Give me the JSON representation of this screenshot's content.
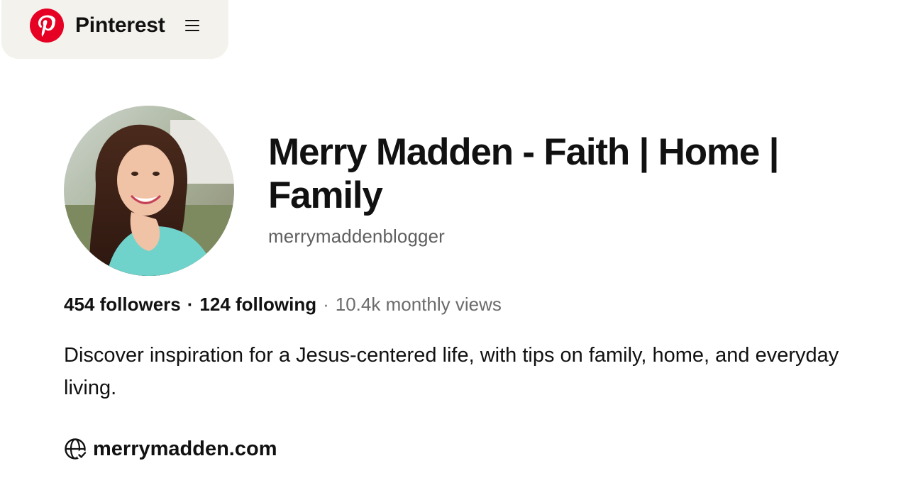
{
  "header": {
    "brand_name": "Pinterest",
    "logo_icon": "pinterest-logo",
    "menu_icon": "hamburger-menu-icon",
    "brand_color": "#e60023",
    "pill_color": "#f4f2ed"
  },
  "profile": {
    "avatar": "profile-photo",
    "name": "Merry Madden - Faith | Home | Family",
    "username": "merrymaddenblogger",
    "stats": {
      "followers": "454 followers",
      "separator": "·",
      "following": "124 following",
      "monthly_views": "10.4k monthly views"
    },
    "bio": "Discover inspiration for a Jesus-centered life, with tips on family, home, and everyday living.",
    "website_icon": "globe-verified-icon",
    "website": "merrymadden.com"
  }
}
